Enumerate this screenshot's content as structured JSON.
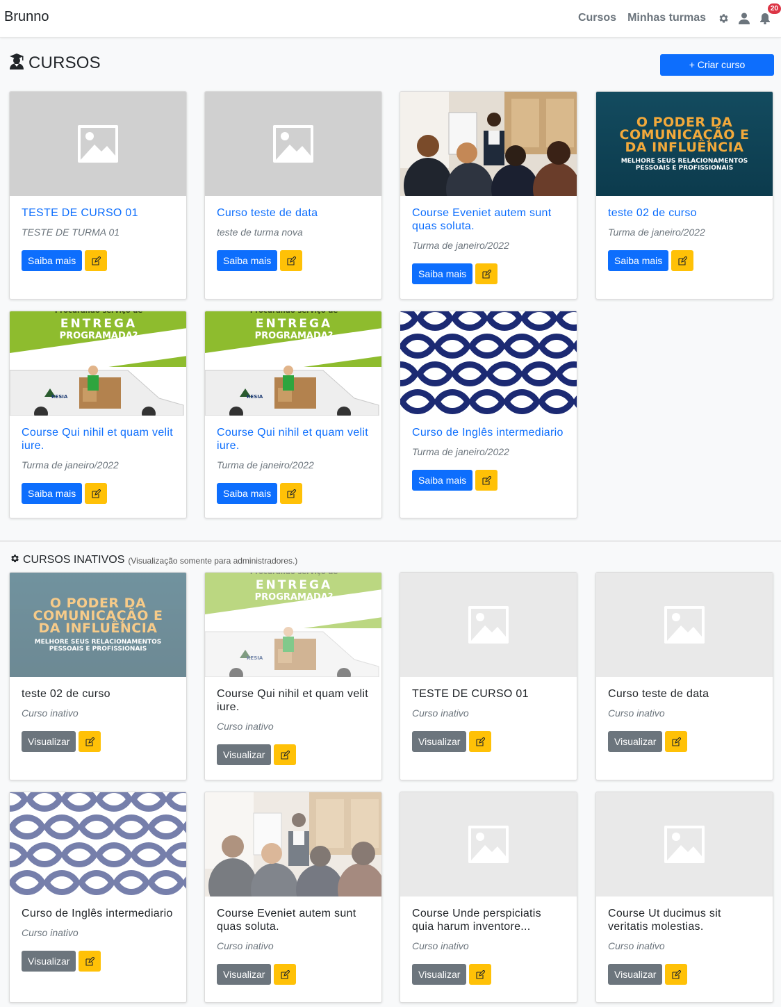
{
  "navbar": {
    "brand": "Brunno",
    "links": [
      "Cursos",
      "Minhas turmas"
    ],
    "notification_count": "20",
    "icons": [
      "gear-icon",
      "user-icon",
      "bell-icon"
    ]
  },
  "header": {
    "title": "CURSOS",
    "icon": "graduate-icon",
    "create_label": "+ Criar curso"
  },
  "active_courses": [
    {
      "title": "TESTE DE CURSO 01",
      "subtitle": "TESTE DE TURMA 01",
      "button": "Saiba mais",
      "image": "placeholder"
    },
    {
      "title": "Curso teste de data",
      "subtitle": "teste de turma nova",
      "button": "Saiba mais",
      "image": "placeholder"
    },
    {
      "title": "Course Eveniet autem sunt quas soluta.",
      "subtitle": "Turma de janeiro/2022",
      "button": "Saiba mais",
      "image": "meeting"
    },
    {
      "title": "teste 02 de curso",
      "subtitle": "Turma de janeiro/2022",
      "button": "Saiba mais",
      "image": "communication"
    },
    {
      "title": "Course Qui nihil et quam velit iure.",
      "subtitle": "Turma de janeiro/2022",
      "button": "Saiba mais",
      "image": "delivery"
    },
    {
      "title": "Course Qui nihil et quam velit iure.",
      "subtitle": "Turma de janeiro/2022",
      "button": "Saiba mais",
      "image": "delivery"
    },
    {
      "title": "Curso de Inglês intermediario",
      "subtitle": "Turma de janeiro/2022",
      "button": "Saiba mais",
      "image": "pattern"
    }
  ],
  "inactive_section": {
    "title": "CURSOS INATIVOS",
    "note": "(Visualização somente para administradores.)"
  },
  "inactive_courses": [
    {
      "title": "teste 02 de curso",
      "subtitle": "Curso inativo",
      "button": "Visualizar",
      "image": "communication"
    },
    {
      "title": "Course Qui nihil et quam velit iure.",
      "subtitle": "Curso inativo",
      "button": "Visualizar",
      "image": "delivery"
    },
    {
      "title": "TESTE DE CURSO 01",
      "subtitle": "Curso inativo",
      "button": "Visualizar",
      "image": "placeholder"
    },
    {
      "title": "Curso teste de data",
      "subtitle": "Curso inativo",
      "button": "Visualizar",
      "image": "placeholder"
    },
    {
      "title": "Curso de Inglês intermediario",
      "subtitle": "Curso inativo",
      "button": "Visualizar",
      "image": "pattern"
    },
    {
      "title": "Course Eveniet autem sunt quas soluta.",
      "subtitle": "Curso inativo",
      "button": "Visualizar",
      "image": "meeting"
    },
    {
      "title": "Course Unde perspiciatis quia harum inventore...",
      "subtitle": "Curso inativo",
      "button": "Visualizar",
      "image": "placeholder"
    },
    {
      "title": "Course Ut ducimus sit veritatis molestias.",
      "subtitle": "Curso inativo",
      "button": "Visualizar",
      "image": "placeholder"
    }
  ],
  "image_text": {
    "communication": {
      "line1": "O PODER DA",
      "line2": "COMUNICAÇÃO E",
      "line3": "DA INFLUÊNCIA",
      "sub1": "MELHORE SEUS RELACIONAMENTOS",
      "sub2": "PESSOAIS E PROFISSIONAIS"
    },
    "delivery": {
      "top": "Procurando serviço de",
      "line1": "ENTREGA",
      "line2": "PROGRAMADA?",
      "brand": "KESIA"
    }
  },
  "colors": {
    "primary": "#0d6efd",
    "secondary": "#6c757d",
    "warning": "#ffc107",
    "danger": "#dc3545"
  }
}
